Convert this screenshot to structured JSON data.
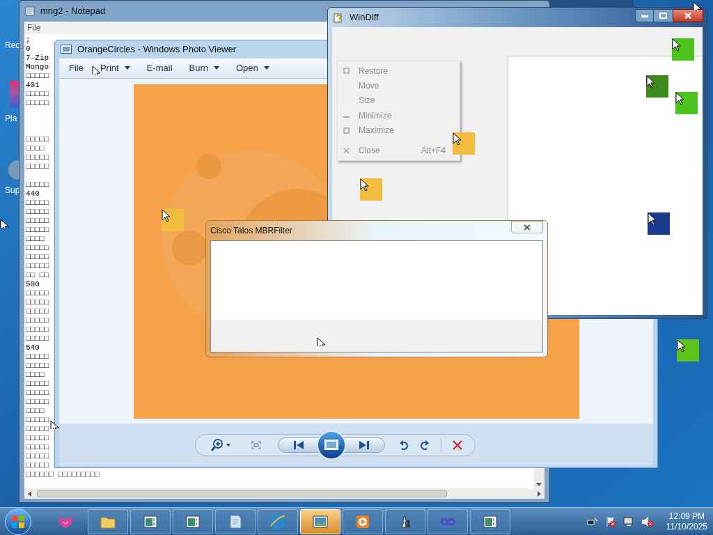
{
  "desktop_icons": [
    {
      "label": "Rec"
    },
    {
      "label": "Pla"
    },
    {
      "label": "Sup"
    }
  ],
  "notepad": {
    "title": "mng2 - Notepad",
    "menu": [
      "File"
    ],
    "text": ";\n0\n7-Zip\nMongo\n□□□□□\n401\n□□□□□\n□□□□□\n\n\n\n□□□□□\n□□□□\n□□□□□\n□□□□□\n\n□□□□□\n440\n□□□□□\n□□□□□\n□□□□□\n□□□□□\n□□□□\n□□□□□\n□□□□□\n□□□□□\n□□ □□\n500\n□□□□□\n□□□□□\n□□□□□\n□□□□□\n□□□□□\n□□□□□\n540\n□□□□□\n□□□□□\n□□□□\n□□□□□\n□□□□□\n□□□□□\n□□□□\n□□□□□\n□□□□□\n□□□□□\n□□□□□\n□□□□□\n□□□□□\n□□□□□□ □□□□□□□□□"
  },
  "photo_viewer": {
    "title": "OrangeCircles - Windows Photo Viewer",
    "toolbar": [
      {
        "label": "File",
        "dropdown": false
      },
      {
        "label": "Print",
        "dropdown": true
      },
      {
        "label": "E-mail",
        "dropdown": false
      },
      {
        "label": "Burn",
        "dropdown": true
      },
      {
        "label": "Open",
        "dropdown": true
      }
    ]
  },
  "windiff": {
    "title": "WinDiff",
    "system_menu": [
      {
        "kind": "restore",
        "label": "Restore",
        "disabled": true
      },
      {
        "kind": "plain",
        "label": "Move",
        "disabled": true
      },
      {
        "kind": "plain",
        "label": "Size",
        "disabled": true
      },
      {
        "kind": "minimize",
        "label": "Minimize",
        "disabled": true
      },
      {
        "kind": "maximize",
        "label": "Maximize",
        "disabled": true
      },
      {
        "kind": "close",
        "label": "Close",
        "shortcut": "Alt+F4",
        "disabled": true
      }
    ]
  },
  "mbrfilter": {
    "title": "Cisco Talos MBRFilter"
  },
  "taskbar": {
    "items": [
      {
        "kind": "cat",
        "selected": false
      },
      {
        "kind": "folder",
        "selected": false
      },
      {
        "kind": "window",
        "selected": false
      },
      {
        "kind": "window",
        "selected": false
      },
      {
        "kind": "notepad",
        "selected": false
      },
      {
        "kind": "browser",
        "selected": false
      },
      {
        "kind": "photos",
        "selected": true
      },
      {
        "kind": "media",
        "selected": false
      },
      {
        "kind": "chess",
        "selected": false
      },
      {
        "kind": "infinity",
        "selected": false
      },
      {
        "kind": "window",
        "selected": false
      }
    ],
    "clock": {
      "time": "12:09 PM",
      "date": "11/10/2025"
    }
  }
}
